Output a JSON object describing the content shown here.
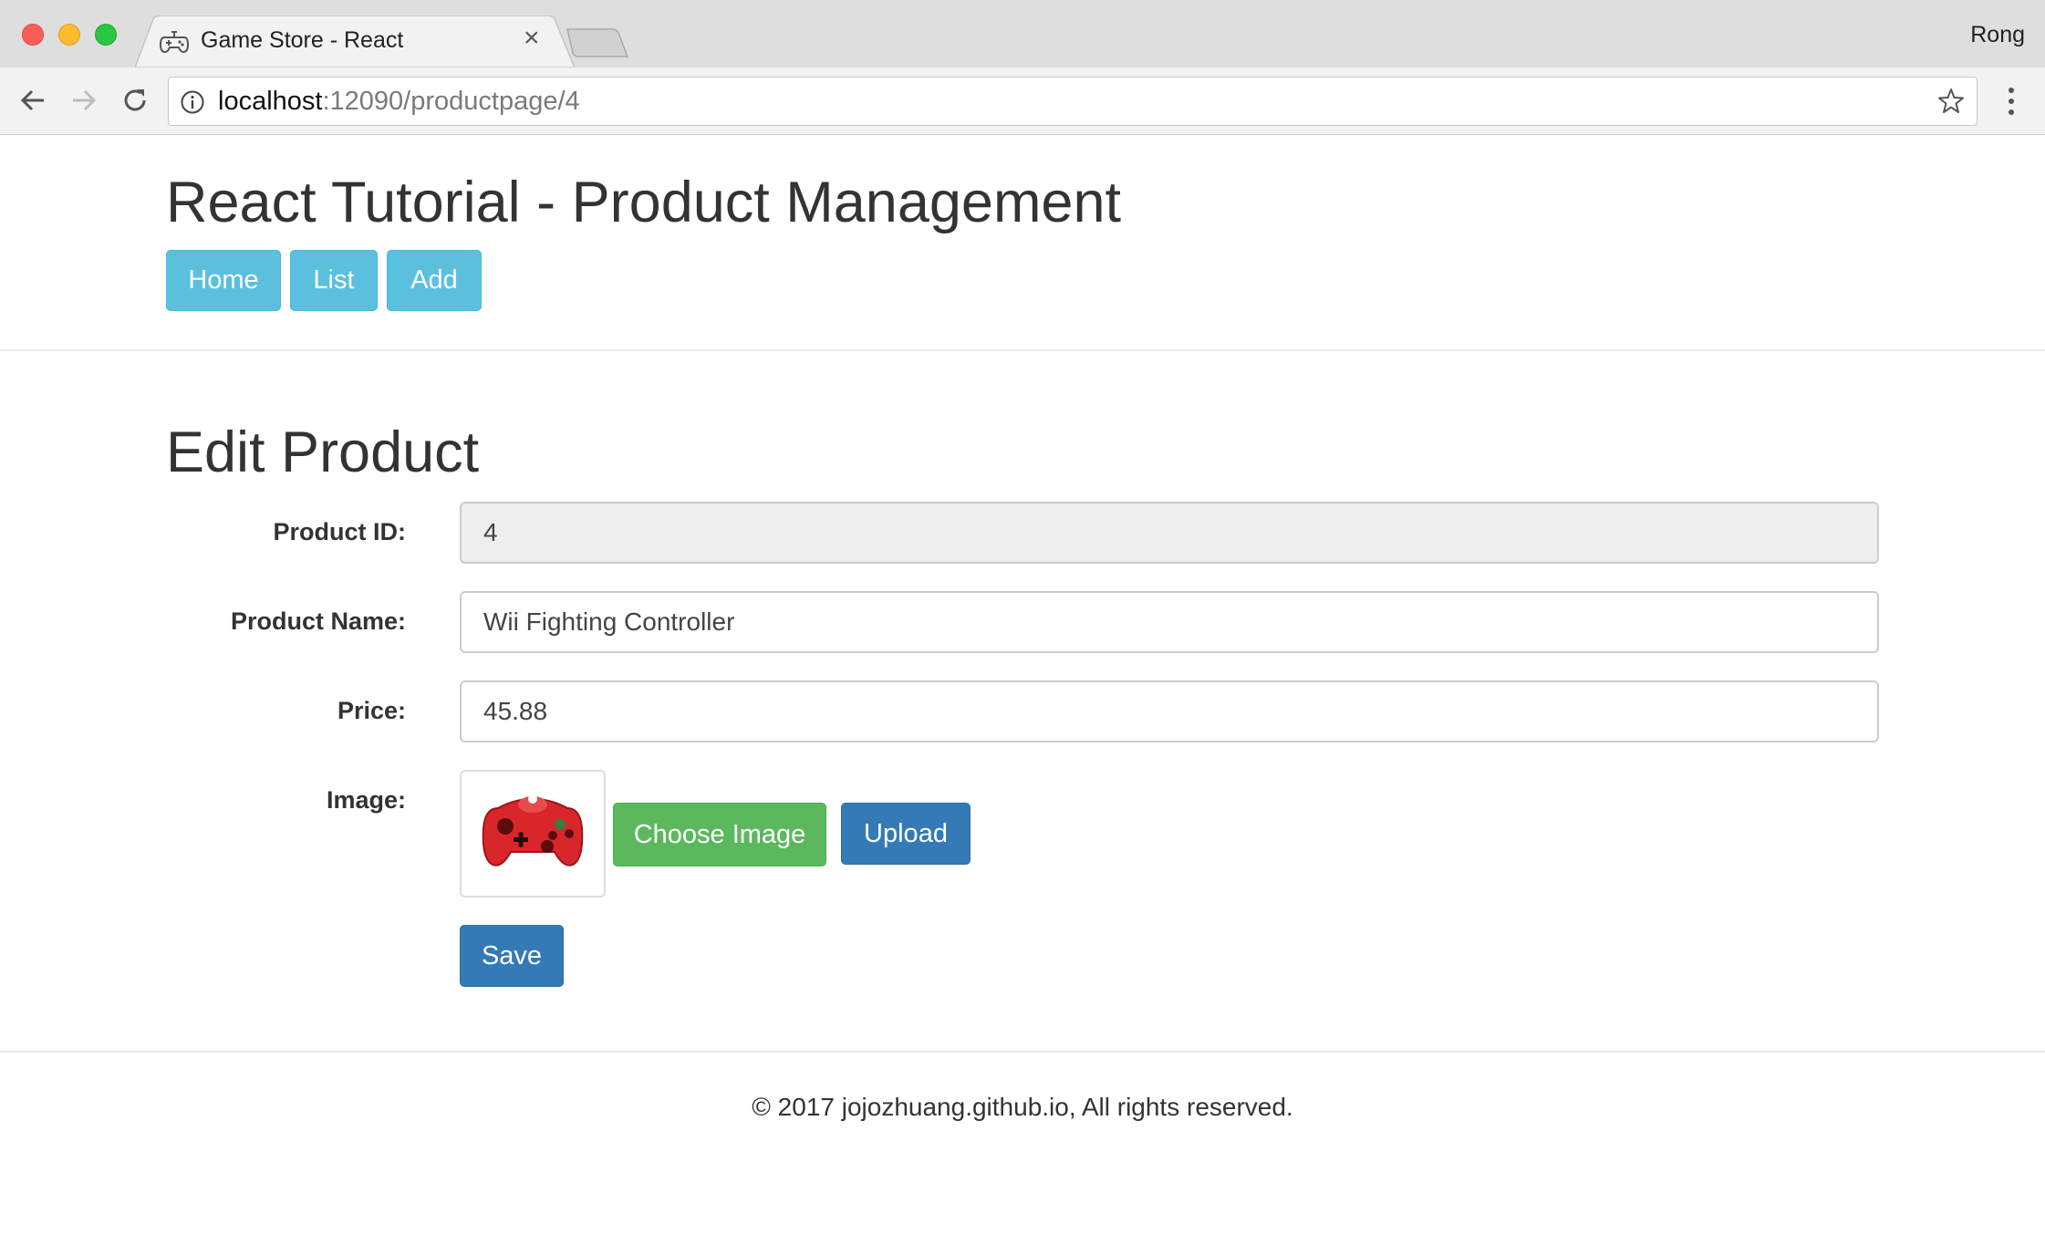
{
  "browser": {
    "tab_title": "Game Store - React",
    "tab_icon": "gamepad-icon",
    "close_tab": "×",
    "profile_name": "Rong",
    "url_host": "localhost",
    "url_path": ":12090/productpage/4"
  },
  "header": {
    "title": "React Tutorial - Product Management",
    "nav": {
      "home": "Home",
      "list": "List",
      "add": "Add"
    }
  },
  "form": {
    "title": "Edit Product",
    "product_id_label": "Product ID:",
    "product_id_value": "4",
    "product_name_label": "Product Name:",
    "product_name_value": "Wii Fighting Controller",
    "price_label": "Price:",
    "price_value": "45.88",
    "image_label": "Image:",
    "image_icon": "red-game-controller-image",
    "choose_image_label": "Choose Image",
    "upload_label": "Upload",
    "save_label": "Save"
  },
  "footer": {
    "text": "© 2017 jojozhuang.github.io, All rights reserved."
  },
  "colors": {
    "info": "#5bc0de",
    "success": "#5cb85c",
    "primary": "#337ab7"
  }
}
